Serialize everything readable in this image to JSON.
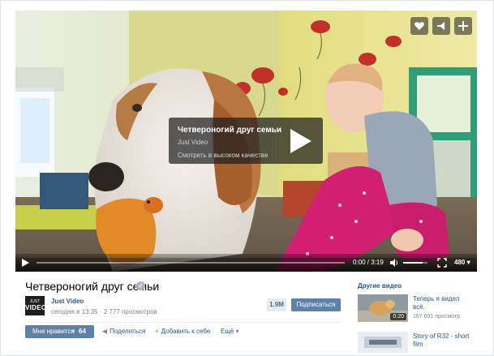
{
  "player": {
    "info_title": "Четвероногий друг семьи",
    "info_author": "Just Video",
    "info_hq": "Смотреть в высоком качестве",
    "time": "0:00 / 3:19",
    "quality": "480",
    "progress": 0,
    "volume": 0.8,
    "corner_buttons": [
      "heart-icon",
      "share-icon",
      "plus-icon"
    ]
  },
  "video": {
    "title": "Четвероногий друг семьи",
    "channel": {
      "logo_line1": "JUST",
      "logo_line2": "VIDEO",
      "name": "Just Video",
      "meta": "сегодня в 13:35 · 2 777 просмотров"
    },
    "subscribers": "1.9M",
    "subscribe_label": "Подписаться"
  },
  "actions": {
    "like_label": "Мне нравится",
    "like_count": "64",
    "share_label": "Поделиться",
    "add_label": "Добавить к себе",
    "more_label": "Ещё"
  },
  "sidebar": {
    "heading": "Другие видео",
    "items": [
      {
        "title": "Теперь я видел всё.",
        "views": "167 691 просмотр",
        "duration": "0:20"
      },
      {
        "title": "Story of R32 - short film",
        "views": "",
        "duration": ""
      }
    ]
  },
  "colors": {
    "accent": "#5e81a8",
    "link": "#2a5885",
    "muted": "#7d8590"
  }
}
